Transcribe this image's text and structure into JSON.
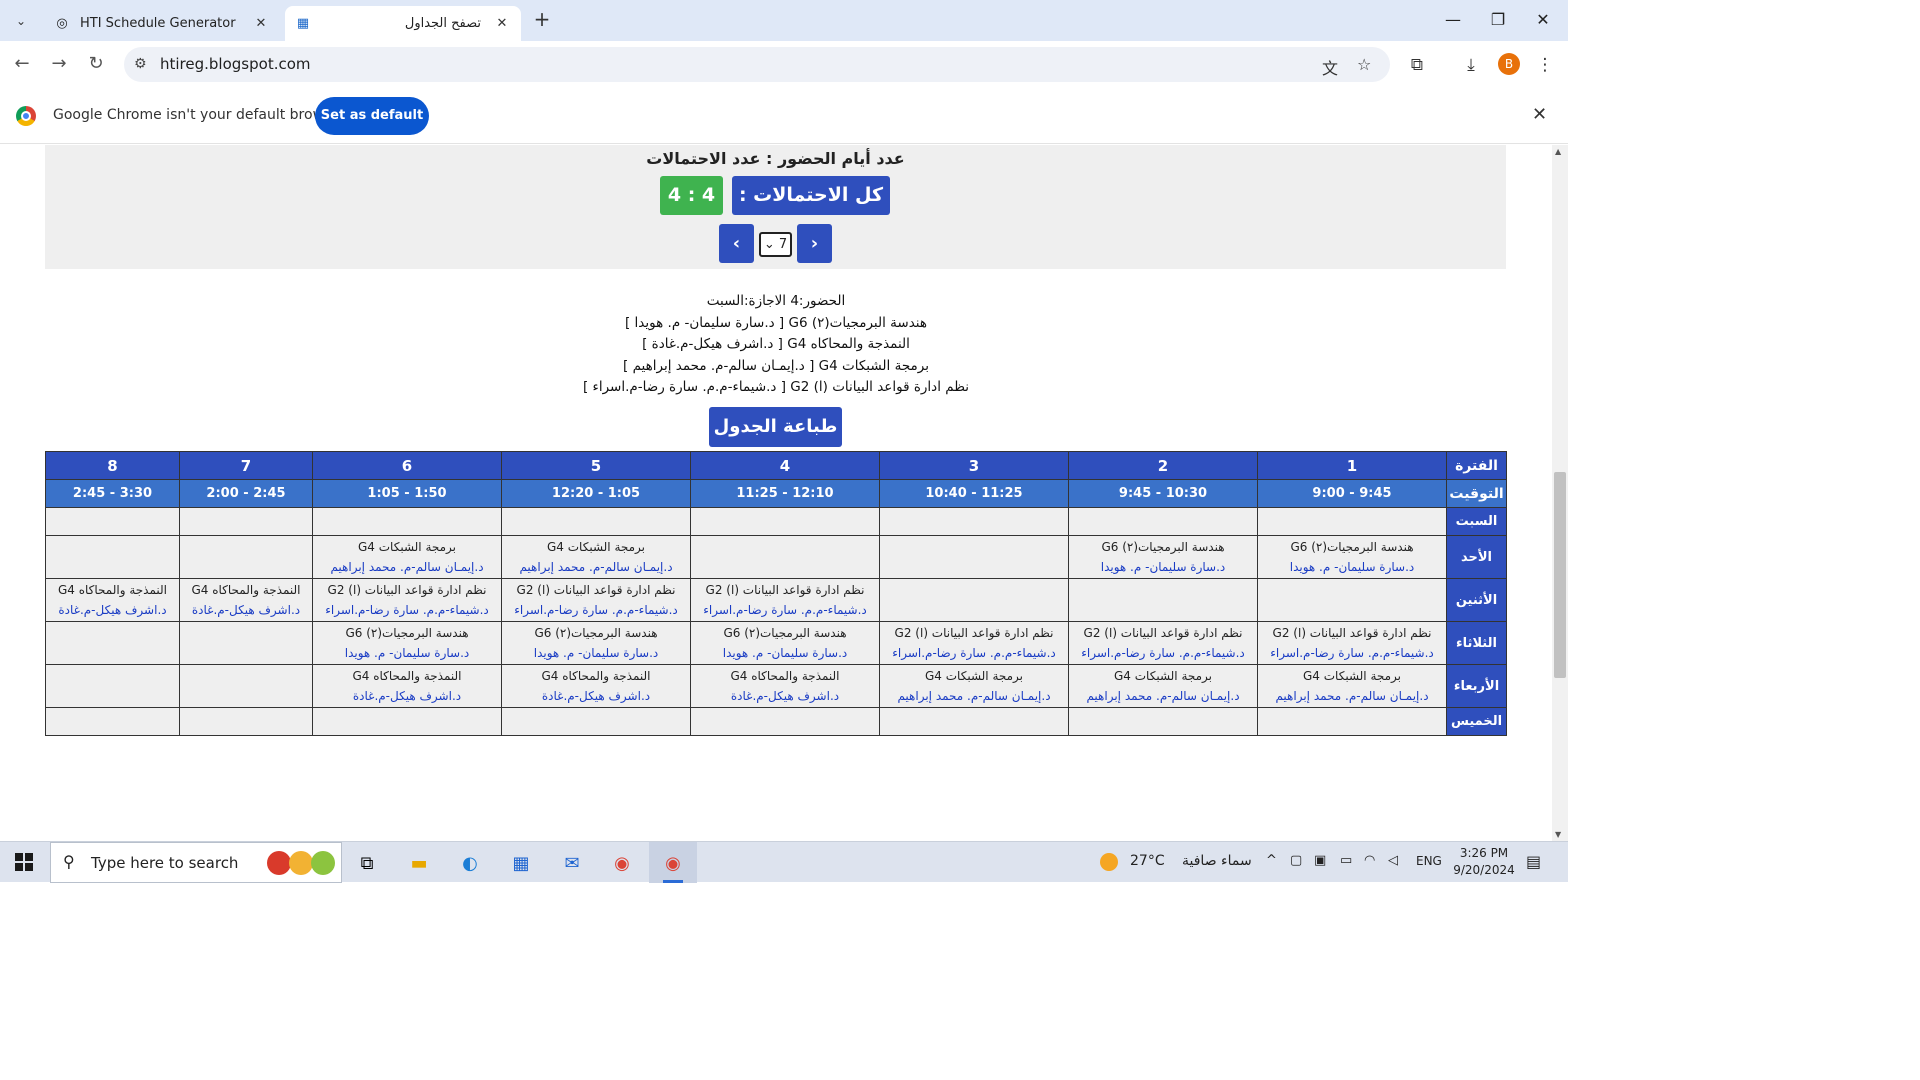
{
  "browser": {
    "tabs": [
      {
        "title": "HTI Schedule Generator",
        "icon": "document-icon"
      },
      {
        "title": "تصفح الجداول",
        "icon": "site-favicon"
      }
    ],
    "url": "htireg.blogspot.com",
    "profile_initial": "B",
    "infobar": {
      "message": "Google Chrome isn't your default browser",
      "button": "Set as default"
    }
  },
  "panel": {
    "title": "عدد أيام الحضور : عدد الاحتمالات",
    "total_label": "كل الاحتمالات : 7",
    "ratio": "4 : 4",
    "selected_option": "7",
    "prev": "‹",
    "next": "›"
  },
  "summary": {
    "attendance": "الحضور:4 الاجازة:السبت",
    "lines": [
      "هندسة البرمجيات(٢) G6 [ د.سارة سليمان- م. هويدا ]",
      "النمذجة والمحاكاه G4 [ د.اشرف هيكل-م.غادة ]",
      "برمجة الشبكات G4 [ د.إيمـان سالم-م. محمد إبراهيم ]",
      "نظم ادارة قواعد البيانات (ا) G2 [ د.شيماء-م.م. سارة رضا-م.اسراء ]"
    ],
    "print_button": "طباعة الجدول"
  },
  "schedule": {
    "period_label": "الفترة",
    "time_label": "التوقيت",
    "periods": [
      "1",
      "2",
      "3",
      "4",
      "5",
      "6",
      "7",
      "8"
    ],
    "times": [
      "9:45 - 9:00",
      "10:30 - 9:45",
      "11:25 - 10:40",
      "12:10 - 11:25",
      "1:05 - 12:20",
      "1:50 - 1:05",
      "2:45 - 2:00",
      "3:30 - 2:45"
    ],
    "days": [
      {
        "name": "السبت",
        "cells": [
          null,
          null,
          null,
          null,
          null,
          null,
          null,
          null
        ]
      },
      {
        "name": "الأحد",
        "cells": [
          {
            "course": "هندسة البرمجيات(٢) G6",
            "teacher": "د.سارة سليمان- م. هويدا"
          },
          {
            "course": "هندسة البرمجيات(٢) G6",
            "teacher": "د.سارة سليمان- م. هويدا"
          },
          null,
          null,
          {
            "course": "برمجة الشبكات G4",
            "teacher": "د.إيمـان سالم-م. محمد إبراهيم"
          },
          {
            "course": "برمجة الشبكات G4",
            "teacher": "د.إيمـان سالم-م. محمد إبراهيم"
          },
          null,
          null
        ]
      },
      {
        "name": "الأثنين",
        "cells": [
          null,
          null,
          null,
          {
            "course": "نظم ادارة قواعد البيانات (ا) G2",
            "teacher": "د.شيماء-م.م. سارة رضا-م.اسراء"
          },
          {
            "course": "نظم ادارة قواعد البيانات (ا) G2",
            "teacher": "د.شيماء-م.م. سارة رضا-م.اسراء"
          },
          {
            "course": "نظم ادارة قواعد البيانات (ا) G2",
            "teacher": "د.شيماء-م.م. سارة رضا-م.اسراء"
          },
          {
            "course": "النمذجة والمحاكاه G4",
            "teacher": "د.اشرف هيكل-م.غادة"
          },
          {
            "course": "النمذجة والمحاكاه G4",
            "teacher": "د.اشرف هيكل-م.غادة"
          }
        ]
      },
      {
        "name": "الثلاثاء",
        "cells": [
          {
            "course": "نظم ادارة قواعد البيانات (ا) G2",
            "teacher": "د.شيماء-م.م. سارة رضا-م.اسراء"
          },
          {
            "course": "نظم ادارة قواعد البيانات (ا) G2",
            "teacher": "د.شيماء-م.م. سارة رضا-م.اسراء"
          },
          {
            "course": "نظم ادارة قواعد البيانات (ا) G2",
            "teacher": "د.شيماء-م.م. سارة رضا-م.اسراء"
          },
          {
            "course": "هندسة البرمجيات(٢) G6",
            "teacher": "د.سارة سليمان- م. هويدا"
          },
          {
            "course": "هندسة البرمجيات(٢) G6",
            "teacher": "د.سارة سليمان- م. هويدا"
          },
          {
            "course": "هندسة البرمجيات(٢) G6",
            "teacher": "د.سارة سليمان- م. هويدا"
          },
          null,
          null
        ]
      },
      {
        "name": "الأربعاء",
        "cells": [
          {
            "course": "برمجة الشبكات G4",
            "teacher": "د.إيمـان سالم-م. محمد إبراهيم"
          },
          {
            "course": "برمجة الشبكات G4",
            "teacher": "د.إيمـان سالم-م. محمد إبراهيم"
          },
          {
            "course": "برمجة الشبكات G4",
            "teacher": "د.إيمـان سالم-م. محمد إبراهيم"
          },
          {
            "course": "النمذجة والمحاكاه G4",
            "teacher": "د.اشرف هيكل-م.غادة"
          },
          {
            "course": "النمذجة والمحاكاه G4",
            "teacher": "د.اشرف هيكل-م.غادة"
          },
          {
            "course": "النمذجة والمحاكاه G4",
            "teacher": "د.اشرف هيكل-م.غادة"
          },
          null,
          null
        ]
      },
      {
        "name": "الخميس",
        "cells": [
          null,
          null,
          null,
          null,
          null,
          null,
          null,
          null
        ]
      }
    ]
  },
  "taskbar": {
    "search_placeholder": "Type here to search",
    "weather_temp": "27°C",
    "weather_desc": "سماء صافية",
    "language": "ENG",
    "time": "3:26 PM",
    "date": "9/20/2024"
  }
}
